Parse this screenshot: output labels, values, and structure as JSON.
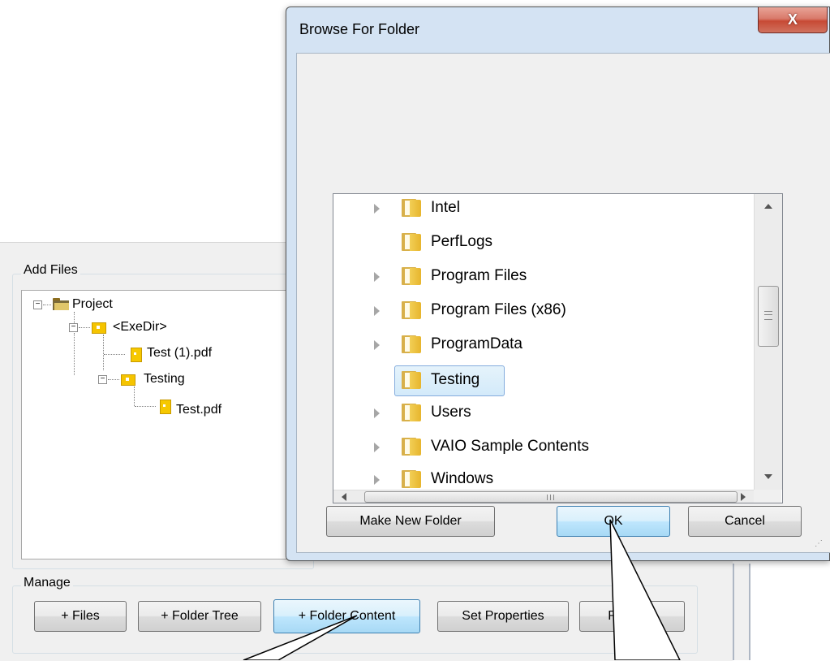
{
  "app": {
    "add_files_group": "Add Files",
    "manage_group": "Manage",
    "tree": [
      {
        "label": "Project"
      },
      {
        "label": "<ExeDir>"
      },
      {
        "label": "Test (1).pdf"
      },
      {
        "label": "Testing"
      },
      {
        "label": "Test.pdf"
      }
    ],
    "buttons": {
      "files": "+ Files",
      "folder_tree": "+ Folder Tree",
      "folder_content": "+ Folder Content",
      "set_properties": "Set Properties",
      "remove": "Remove"
    }
  },
  "dialog": {
    "title": "Browse For Folder",
    "close_glyph": "X",
    "folders": [
      {
        "label": "Intel",
        "has_children": true
      },
      {
        "label": "PerfLogs",
        "has_children": false
      },
      {
        "label": "Program Files",
        "has_children": true
      },
      {
        "label": "Program Files (x86)",
        "has_children": true
      },
      {
        "label": "ProgramData",
        "has_children": true
      },
      {
        "label": "Testing",
        "has_children": false,
        "selected": true
      },
      {
        "label": "Users",
        "has_children": true
      },
      {
        "label": "VAIO Sample Contents",
        "has_children": true
      },
      {
        "label": "Windows",
        "has_children": true
      }
    ],
    "buttons": {
      "make_new_folder": "Make New Folder",
      "ok": "OK",
      "cancel": "Cancel"
    }
  },
  "colors": {
    "dialog_frame": "#d4e3f3",
    "close_button": "#c74a35",
    "selection_border": "#84acdd",
    "folder_yellow": "#f5c400"
  }
}
